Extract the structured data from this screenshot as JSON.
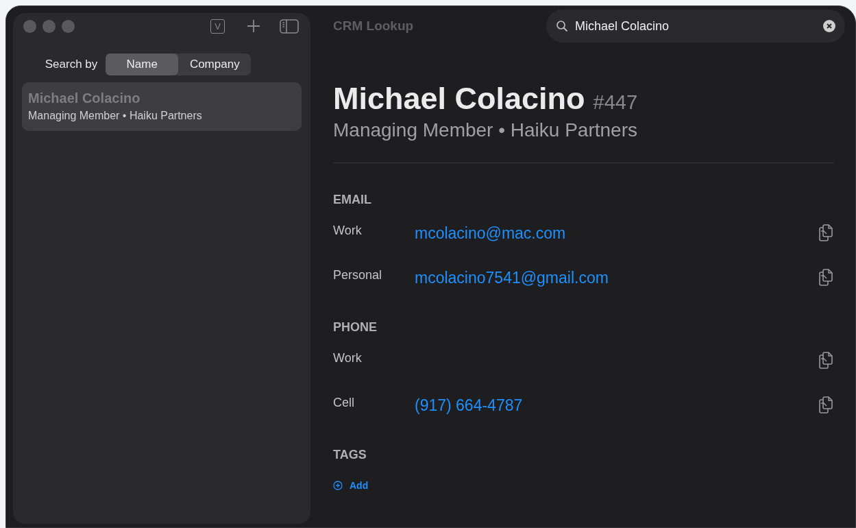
{
  "window": {
    "title": "CRM Lookup"
  },
  "toolbar": {
    "v_key": "V"
  },
  "search": {
    "value": "Michael Colacino"
  },
  "search_by": {
    "label": "Search by",
    "options": [
      {
        "label": "Name",
        "selected": true
      },
      {
        "label": "Company",
        "selected": false
      }
    ]
  },
  "results": [
    {
      "name": "Michael Colacino",
      "subtitle": "Managing Member • Haiku Partners",
      "selected": true
    }
  ],
  "contact": {
    "name": "Michael Colacino",
    "id": "#447",
    "subtitle": "Managing Member • Haiku Partners",
    "sections": [
      {
        "title": "EMAIL",
        "rows": [
          {
            "label": "Work",
            "value": "mcolacino@mac.com"
          },
          {
            "label": "Personal",
            "value": "mcolacino7541@gmail.com"
          }
        ]
      },
      {
        "title": "PHONE",
        "rows": [
          {
            "label": "Work"
          },
          {
            "label": "Cell",
            "value": "(917) 664-4787"
          }
        ]
      }
    ],
    "tags": {
      "title": "TAGS",
      "add_label": "Add"
    }
  }
}
